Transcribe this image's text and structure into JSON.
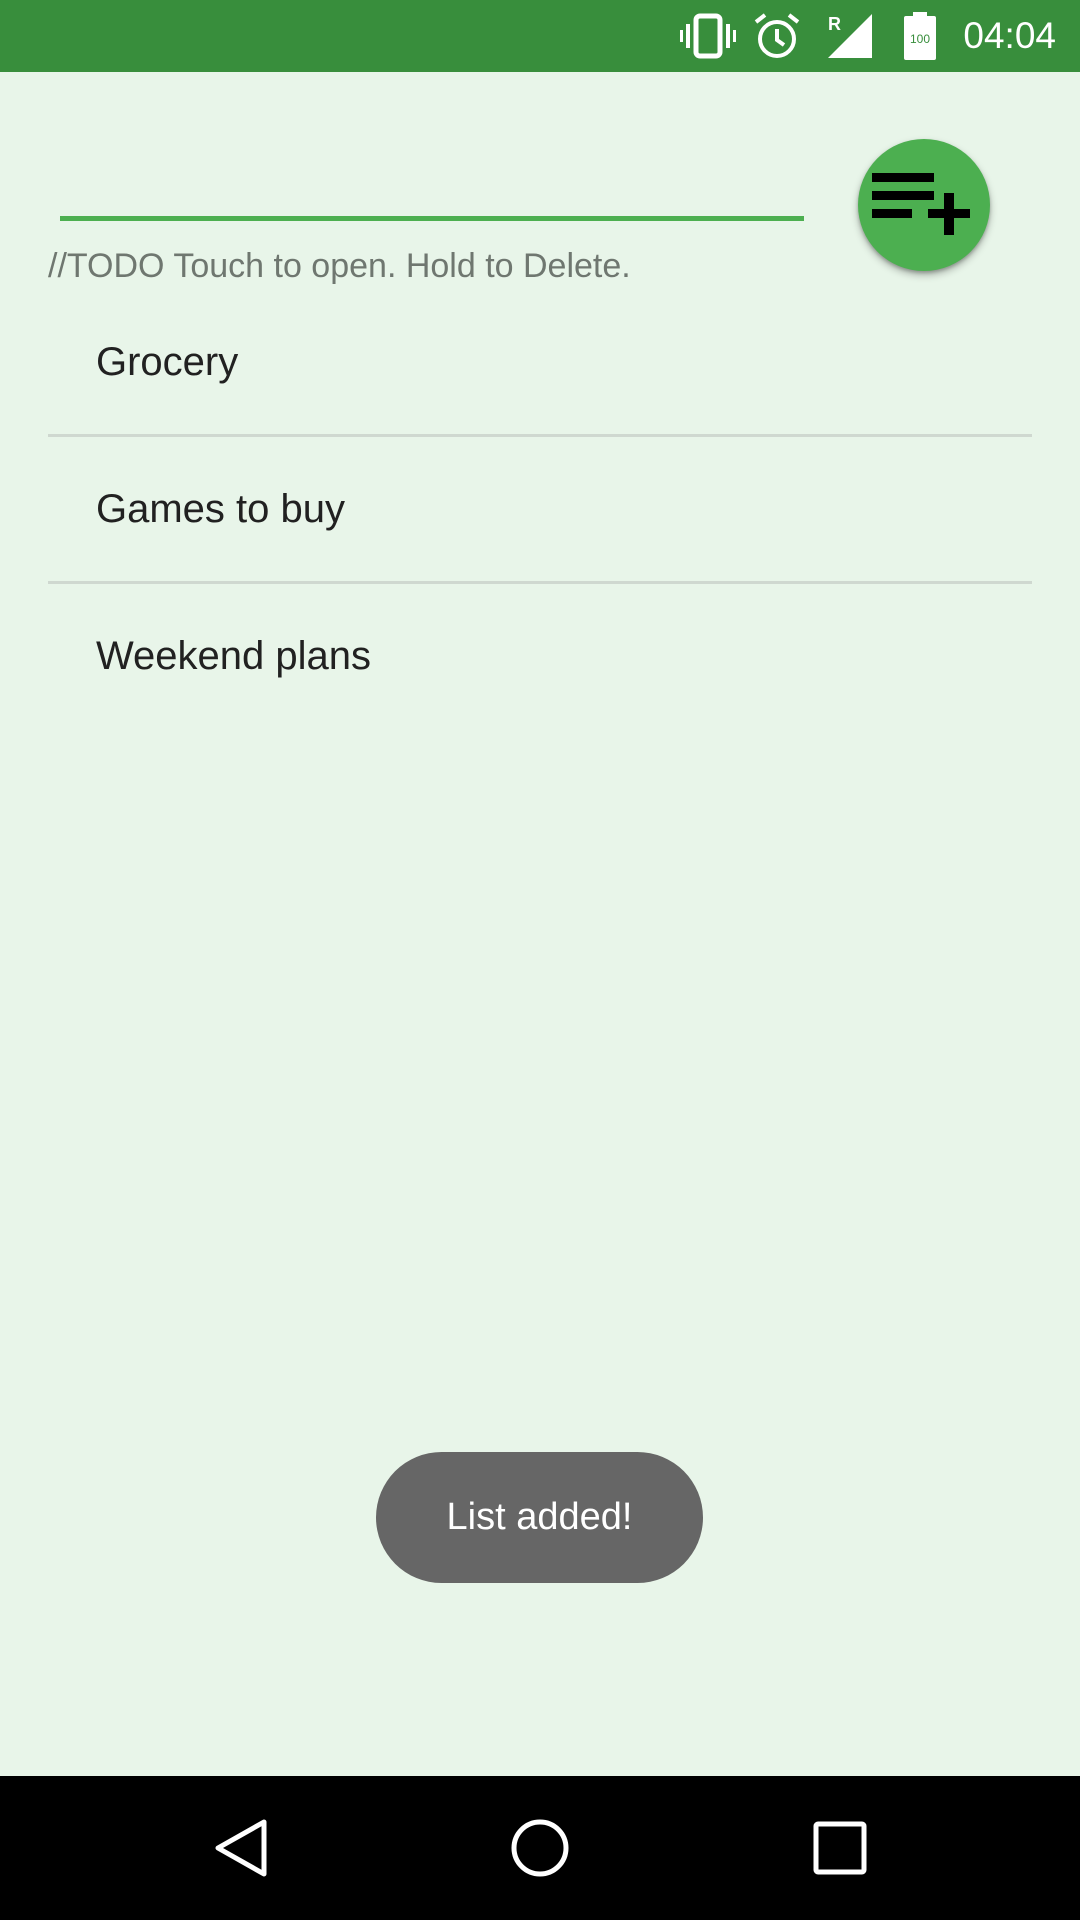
{
  "status_bar": {
    "time": "04:04",
    "icons": [
      "vibrate-icon",
      "alarm-icon",
      "signal-icon",
      "battery-icon"
    ],
    "signal_label": "R",
    "battery_level": "100",
    "background_color": "#388E3C"
  },
  "main": {
    "input_value": "",
    "input_placeholder": "",
    "hint": "//TODO Touch to open. Hold to Delete.",
    "fab_icon": "playlist-add-icon",
    "lists": [
      {
        "label": "Grocery"
      },
      {
        "label": "Games to buy"
      },
      {
        "label": "Weekend plans"
      }
    ]
  },
  "toast": {
    "message": "List added!"
  },
  "nav_bar": {
    "buttons": [
      "back-icon",
      "home-icon",
      "recents-icon"
    ]
  },
  "colors": {
    "accent": "#4CAF50",
    "background": "#E8F5E9",
    "toast_background": "#666666"
  }
}
